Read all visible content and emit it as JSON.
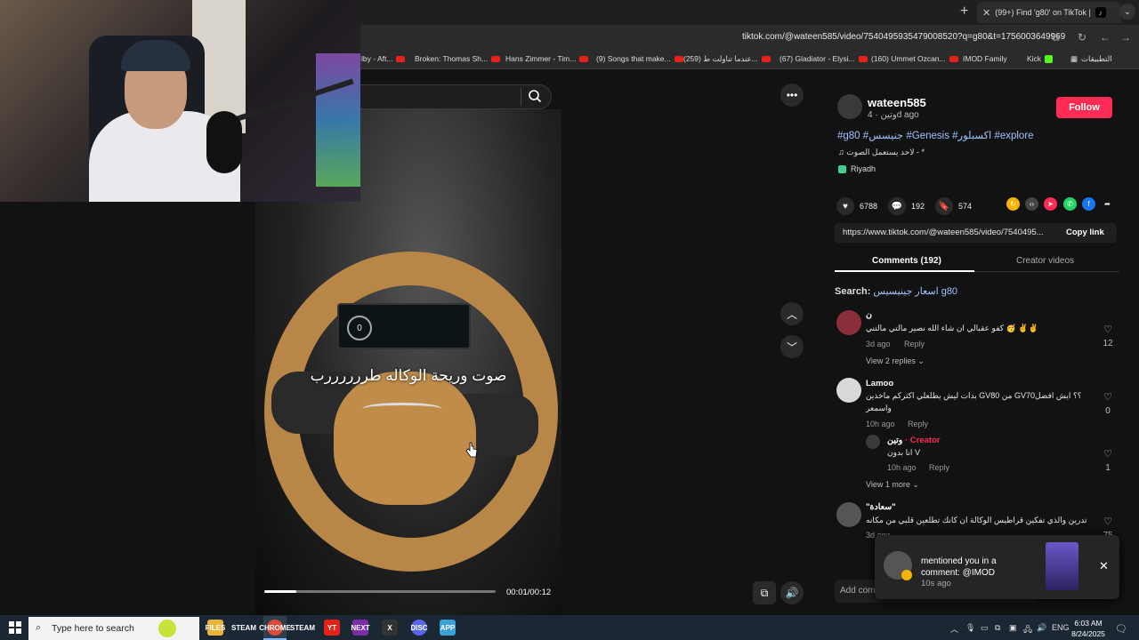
{
  "browser": {
    "tab_title": "(99+) Find 'g80' on TikTok |",
    "url": "tiktok.com/@wateen585/video/7540495935479008520?q=g80&t=1756003649969",
    "bookmarks": [
      "lby - Aft...",
      "Broken: Thomas Sh...",
      "Hans Zimmer - Tim...",
      "(9) Songs that make...",
      "(259) عندما تناولت ط...",
      "(67) Gladiator - Elysi...",
      "(160) Ummet Ozcan...",
      "IMOD Family",
      "Kick",
      "التطبيقات"
    ]
  },
  "video": {
    "caption": "صوت وريحة الوكاله طررررررب",
    "gauge_value": "0",
    "time": "00:01/00:12",
    "progress": 0.14
  },
  "author": {
    "username": "wateen585",
    "sub": "وتين · 4d ago",
    "follow_label": "Follow",
    "tags": "#g80 #جنيسس #Genesis #اكسبلور #explore",
    "music": "♫  لاحد يستعمل الصوت - *",
    "location": "Riyadh"
  },
  "stats": {
    "likes": "6788",
    "comments": "192",
    "saves": "574"
  },
  "link": {
    "url": "https://www.tiktok.com/@wateen585/video/7540495...",
    "copy_label": "Copy link"
  },
  "tabs": {
    "comments": "Comments (192)",
    "creator": "Creator videos"
  },
  "comment_search": {
    "prefix": "Search: ",
    "query": "اسعار جينيسيس g80"
  },
  "comments": [
    {
      "name": "ن",
      "text": "كفو عقبالي ان شاء الله نصير مالتي مالتني 🥳 ✌️✌️",
      "time": "3d ago",
      "reply": "Reply",
      "likes": "12",
      "more": "View 2 replies"
    },
    {
      "name": "Lamoo",
      "text": "بدات ليش يطلعلي اكثركم ماخذين GV80 من GV70؟؟ ايش افضل",
      "text2": "واسمعر",
      "time": "10h ago",
      "reply": "Reply",
      "likes": "0"
    },
    {
      "name": "وتين",
      "creator": " · Creator",
      "text": "انا بدون V",
      "time": "10h ago",
      "reply": "Reply",
      "likes": "1",
      "more": "View 1 more"
    },
    {
      "name": "\"سعادة\"",
      "text": "تدرين والذي تفكين قراطيس الوكالة ان كانك تطلعين قلبي من مكانه",
      "time": "3d ago",
      "likes": "75"
    }
  ],
  "add_comment": "Add comment...",
  "notification": {
    "text": "mentioned you in a comment: @IMOD",
    "time": "10s ago"
  },
  "taskbar": {
    "search_placeholder": "Type here to search",
    "apps": [
      "FILES",
      "STEAM",
      "CHROME",
      "STEAM",
      "YT",
      "NEXT",
      "X",
      "DISC",
      "APP"
    ],
    "lang": "ENG",
    "time": "6:03 AM",
    "date": "8/24/2025"
  },
  "colors": {
    "accent": "#fe2c55",
    "link": "#9ec3ff",
    "bg": "#121212"
  }
}
